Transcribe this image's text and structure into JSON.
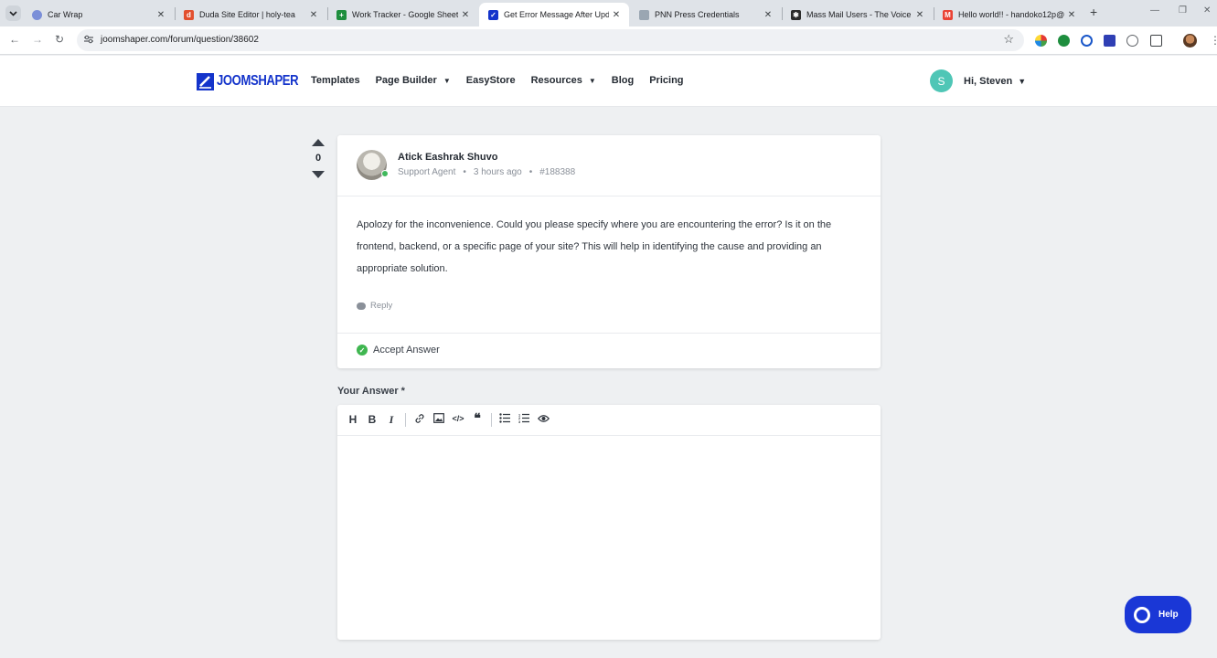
{
  "browser": {
    "tabs": [
      {
        "title": "Car Wrap",
        "active": false
      },
      {
        "title": "Duda Site Editor | holy-tea",
        "active": false
      },
      {
        "title": "Work Tracker - Google Sheets",
        "active": false
      },
      {
        "title": "Get Error Message After Updat",
        "active": true
      },
      {
        "title": "PNN Press Credentials",
        "active": false
      },
      {
        "title": "Mass Mail Users - The Voice of",
        "active": false
      },
      {
        "title": "Hello world!! - handoko12p@g",
        "active": false
      }
    ],
    "url": "joomshaper.com/forum/question/38602"
  },
  "site": {
    "logo_text": "JOOMSHAPER",
    "nav": [
      {
        "label": "Templates",
        "has_dropdown": false
      },
      {
        "label": "Page Builder",
        "has_dropdown": true
      },
      {
        "label": "EasyStore",
        "has_dropdown": false
      },
      {
        "label": "Resources",
        "has_dropdown": true
      },
      {
        "label": "Blog",
        "has_dropdown": false
      },
      {
        "label": "Pricing",
        "has_dropdown": false
      }
    ],
    "user_initial": "S",
    "user_greeting": "Hi, Steven"
  },
  "answer": {
    "vote_count": "0",
    "author_name": "Atick Eashrak Shuvo",
    "author_role": "Support Agent",
    "time_ago": "3 hours ago",
    "post_id": "#188388",
    "body": "Apolozy for the inconvenience. Could you please specify where you are encountering the error? Is it on the frontend, backend, or a specific page of your site? This will help in identifying the cause and providing an appropriate solution.",
    "reply_label": "Reply",
    "accept_label": "Accept Answer"
  },
  "editor": {
    "label": "Your Answer *",
    "content": ""
  },
  "help": {
    "label": "Help"
  },
  "colors": {
    "brand": "#1434cb",
    "help_button": "#1a37d6",
    "avatar": "#4fc6b6",
    "accept_check": "#3fb650"
  }
}
